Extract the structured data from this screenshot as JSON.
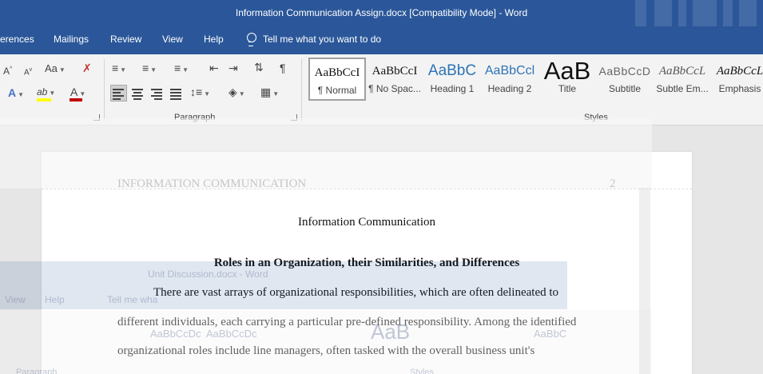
{
  "window": {
    "title": "Information Communication Assign.docx [Compatibility Mode]  -  Word"
  },
  "menu": {
    "tabs": [
      "erences",
      "Mailings",
      "Review",
      "View",
      "Help"
    ],
    "tell_me": "Tell me what you want to do"
  },
  "ribbon": {
    "font_group": {
      "grow_font": "A",
      "shrink_font": "A",
      "change_case": "Aa",
      "text_effects": "A",
      "highlight": "ab",
      "font_color": "A",
      "highlight_color": "#ffff00",
      "font_color_value": "#c00000"
    },
    "paragraph": {
      "label": "Paragraph",
      "show_marks": "¶"
    },
    "styles": {
      "label": "Styles",
      "items": [
        {
          "preview": "AaBbCcI",
          "name": "¶ Normal"
        },
        {
          "preview": "AaBbCcI",
          "name": "¶ No Spac..."
        },
        {
          "preview": "AaBbC",
          "name": "Heading 1"
        },
        {
          "preview": "AaBbCcl",
          "name": "Heading 2"
        },
        {
          "preview": "AaB",
          "name": "Title"
        },
        {
          "preview": "AaBbCcD",
          "name": "Subtitle"
        },
        {
          "preview": "AaBbCcL",
          "name": "Subtle Em..."
        },
        {
          "preview": "AaBbCcL",
          "name": "Emphasis"
        }
      ]
    }
  },
  "document": {
    "header_left": "INFORMATION COMMUNICATION",
    "page_number": "2",
    "title": "Information Communication",
    "heading": "Roles in an Organization, their Similarities, and Differences",
    "lines": [
      "There are vast arrays of organizational responsibilities, which are often delineated to",
      "different individuals, each carrying a particular pre-defined responsibility. Among the identified",
      "organizational roles include line managers, often tasked with the overall business unit's"
    ]
  },
  "ghost_window": {
    "title": "Unit Discussion.docx  -  Word",
    "tabs": [
      "View",
      "Help"
    ],
    "tell_me": "Tell me wha",
    "styles": [
      "AaBbCcDc",
      "AaBbCcDc",
      "AaB",
      "AaBbC"
    ],
    "styles_label": "Styles",
    "paragraph_label": "Paragraph"
  }
}
